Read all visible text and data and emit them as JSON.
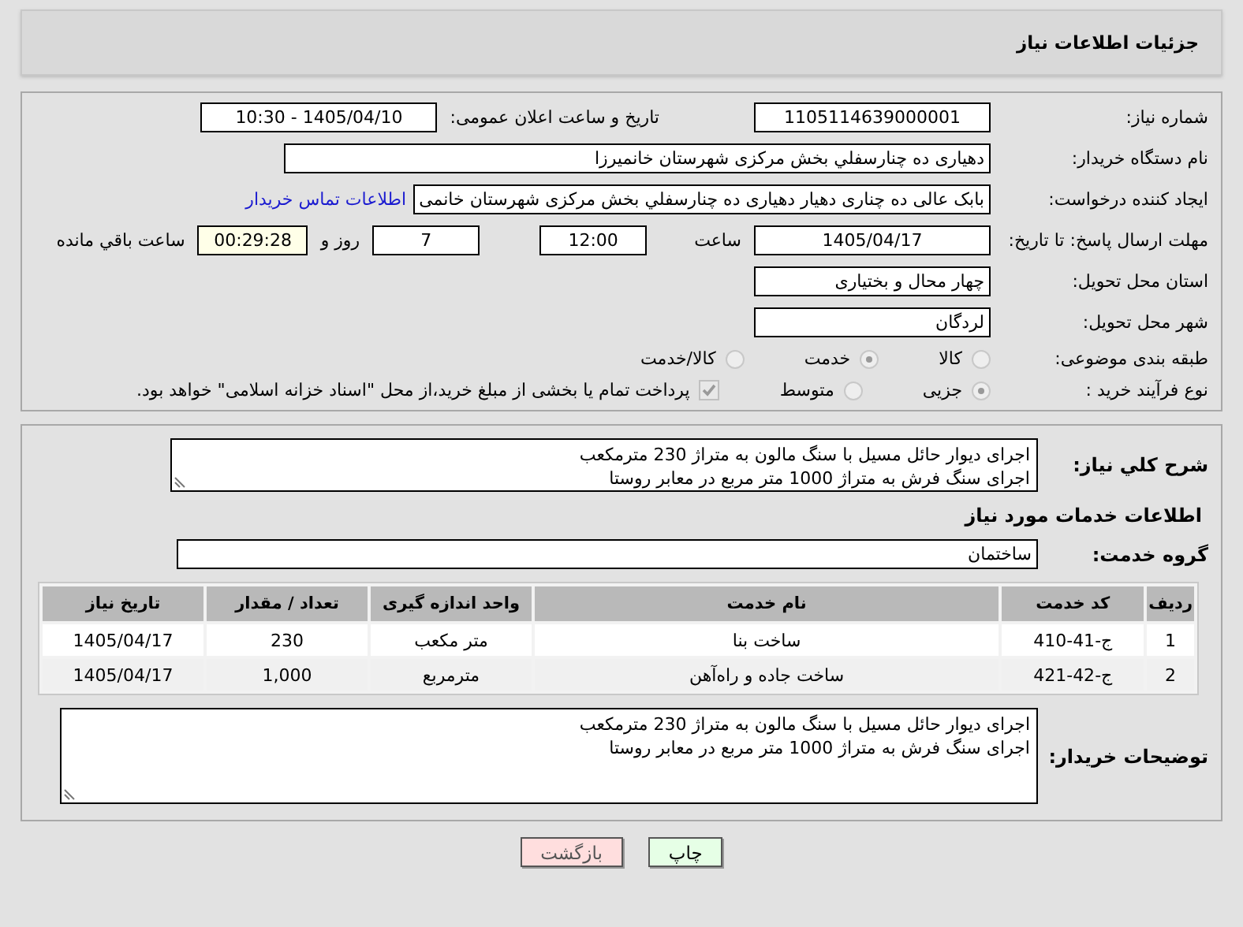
{
  "header": {
    "title": "جزئیات اطلاعات نیاز"
  },
  "need_number": {
    "label": "شماره نیاز:",
    "value": "1105114639000001"
  },
  "announce": {
    "label": "تاریخ و ساعت اعلان عمومی:",
    "value": "1405/04/10 - 10:30"
  },
  "buyer": {
    "label": "نام دستگاه خریدار:",
    "value": "دهیاری ده چنارسفلي بخش مرکزی شهرستان خانمیرزا"
  },
  "requester": {
    "label": "ایجاد کننده درخواست:",
    "value": "بابک عالی ده چناری دهیار دهیاری ده چنارسفلي بخش مرکزی شهرستان خانمی",
    "link": "اطلاعات تماس خریدار"
  },
  "deadline": {
    "label": "مهلت ارسال پاسخ: تا تاریخ:",
    "date": "1405/04/17",
    "time_label": "ساعت",
    "time": "12:00",
    "days": "7",
    "days_label": "روز و",
    "remaining": "00:29:28",
    "remaining_label": "ساعت باقي مانده"
  },
  "province": {
    "label": "استان محل تحویل:",
    "value": "چهار محال و بختیاری"
  },
  "city": {
    "label": "شهر محل تحویل:",
    "value": "لردگان"
  },
  "category": {
    "label": "طبقه بندی موضوعی:",
    "options": [
      {
        "label": "کالا",
        "selected": false
      },
      {
        "label": "خدمت",
        "selected": true
      },
      {
        "label": "کالا/خدمت",
        "selected": false
      }
    ]
  },
  "process": {
    "label": "نوع فرآیند خرید :",
    "options": [
      {
        "label": "جزیی",
        "selected": true
      },
      {
        "label": "متوسط",
        "selected": false
      }
    ],
    "treasury": {
      "label": "پرداخت تمام یا بخشی از مبلغ خرید،از محل \"اسناد خزانه اسلامی\" خواهد بود.",
      "checked": true
    }
  },
  "description": {
    "label": "شرح کلي نیاز:",
    "lines": [
      "اجرای دیوار حائل مسیل با سنگ مالون به متراژ 230 مترمکعب",
      "اجرای سنگ فرش به متراژ 1000 متر مربع در معابر روستا"
    ]
  },
  "services_heading": "اطلاعات خدمات مورد نیاز",
  "service_group": {
    "label": "گروه خدمت:",
    "value": "ساختمان"
  },
  "table": {
    "columns": [
      "ردیف",
      "کد خدمت",
      "نام خدمت",
      "واحد اندازه گیری",
      "تعداد / مقدار",
      "تاریخ نیاز"
    ],
    "rows": [
      [
        "1",
        "ج-41-410",
        "ساخت بنا",
        "متر مکعب",
        "230",
        "1405/04/17"
      ],
      [
        "2",
        "ج-42-421",
        "ساخت جاده و راه‌آهن",
        "مترمربع",
        "1,000",
        "1405/04/17"
      ]
    ]
  },
  "buyer_notes": {
    "label": "توضیحات خریدار:",
    "lines": [
      "اجرای دیوار حائل مسیل با سنگ مالون به متراژ 230 مترمکعب",
      "اجرای سنگ فرش به متراژ 1000 متر مربع در معابر روستا"
    ]
  },
  "buttons": [
    {
      "label": "چاپ",
      "kind": "print"
    },
    {
      "label": "بازگشت",
      "kind": "back"
    }
  ]
}
